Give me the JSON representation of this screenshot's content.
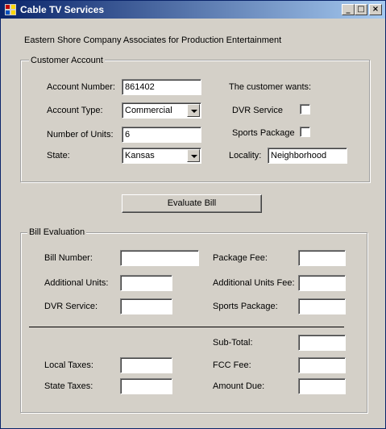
{
  "window": {
    "title": "Cable TV Services"
  },
  "caption_buttons": {
    "minimize": "_",
    "maximize": "□",
    "close": "×"
  },
  "header_text": "Eastern Shore Company Associates for Production Entertainment",
  "customer_account": {
    "group_title": "Customer Account",
    "account_number_label": "Account Number:",
    "account_number_value": "861402",
    "account_type_label": "Account Type:",
    "account_type_value": "Commercial",
    "units_label": "Number of Units:",
    "units_value": "6",
    "state_label": "State:",
    "state_value": "Kansas",
    "wants_label": "The customer wants:",
    "dvr_label": "DVR Service",
    "sports_label": "Sports Package",
    "locality_label": "Locality:",
    "locality_value": "Neighborhood"
  },
  "evaluate_button": "Evaluate Bill",
  "bill_evaluation": {
    "group_title": "Bill Evaluation",
    "bill_number_label": "Bill Number:",
    "additional_units_label": "Additional Units:",
    "dvr_service_label": "DVR Service:",
    "package_fee_label": "Package Fee:",
    "additional_units_fee_label": "Additional Units Fee:",
    "sports_package_label": "Sports Package:",
    "subtotal_label": "Sub-Total:",
    "local_taxes_label": "Local Taxes:",
    "fcc_fee_label": "FCC Fee:",
    "state_taxes_label": "State Taxes:",
    "amount_due_label": "Amount Due:"
  }
}
